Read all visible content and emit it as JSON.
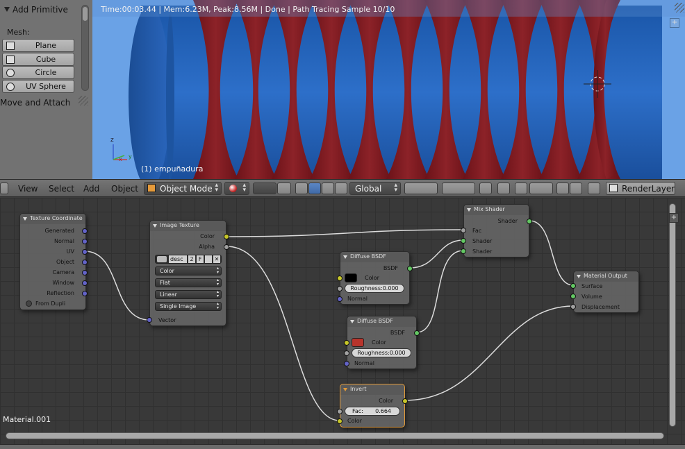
{
  "tool_panel": {
    "title": "Add Primitive",
    "mesh_label": "Mesh:",
    "buttons": [
      {
        "label": "Plane",
        "icon": "plane-icon"
      },
      {
        "label": "Cube",
        "icon": "cube-icon"
      },
      {
        "label": "Circle",
        "icon": "circle-icon"
      },
      {
        "label": "UV Sphere",
        "icon": "uv-sphere-icon"
      }
    ],
    "move_attach": "Move and Attach"
  },
  "viewport": {
    "status": "Time:00:03.44 | Mem:6.23M, Peak:8.56M | Done | Path Tracing Sample 10/10",
    "object_name": "(1) empuñadura",
    "axis_labels": {
      "z": "z",
      "x": "x",
      "y": "y"
    },
    "colors": {
      "background": "#6aa2e6",
      "cylinder_blue": "#1f5fb5",
      "wrap_red": "#7a1a20"
    }
  },
  "header": {
    "menus": [
      "View",
      "Select",
      "Add",
      "Object"
    ],
    "mode": "Object Mode",
    "orientation": "Global",
    "render_layer": "RenderLayer"
  },
  "node_editor": {
    "material_name": "Material.001",
    "nodes": {
      "texture_coordinate": {
        "title": "Texture Coordinate",
        "outputs": [
          "Generated",
          "Normal",
          "UV",
          "Object",
          "Camera",
          "Window",
          "Reflection"
        ],
        "checkbox": "From Dupli"
      },
      "image_texture": {
        "title": "Image Texture",
        "outputs": [
          "Color",
          "Alpha"
        ],
        "image_name": "desc",
        "users": "2",
        "fake": "F",
        "dropdowns": [
          "Color",
          "Flat",
          "Linear",
          "Single Image"
        ],
        "input": "Vector"
      },
      "mix_shader": {
        "title": "Mix Shader",
        "output": "Shader",
        "inputs": [
          "Fac",
          "Shader",
          "Shader"
        ]
      },
      "diffuse_1": {
        "title": "Diffuse BSDF",
        "output": "BSDF",
        "color_label": "Color",
        "color": "#000000",
        "roughness": "Roughness:0.000",
        "normal": "Normal"
      },
      "diffuse_2": {
        "title": "Diffuse BSDF",
        "output": "BSDF",
        "color_label": "Color",
        "color": "#b8342c",
        "roughness": "Roughness:0.000",
        "normal": "Normal"
      },
      "material_output": {
        "title": "Material Output",
        "inputs": [
          "Surface",
          "Volume",
          "Displacement"
        ]
      },
      "invert": {
        "title": "Invert",
        "output": "Color",
        "fac_label": "Fac:",
        "fac_value": "0.664",
        "input": "Color"
      }
    }
  }
}
